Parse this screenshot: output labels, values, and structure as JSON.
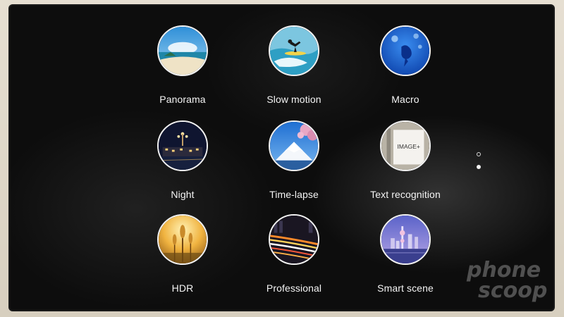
{
  "modes": [
    {
      "label": "Panorama",
      "icon": "panorama-beach-icon"
    },
    {
      "label": "Slow motion",
      "icon": "surfer-icon"
    },
    {
      "label": "Macro",
      "icon": "water-drop-icon"
    },
    {
      "label": "Night",
      "icon": "night-city-icon"
    },
    {
      "label": "Time-lapse",
      "icon": "mountain-blossom-icon"
    },
    {
      "label": "Text recognition",
      "icon": "document-text-icon",
      "thumb_text": "IMAGE+"
    },
    {
      "label": "HDR",
      "icon": "wheat-sunset-icon"
    },
    {
      "label": "Professional",
      "icon": "light-trails-icon"
    },
    {
      "label": "Smart scene",
      "icon": "skyline-icon"
    }
  ],
  "pager": {
    "pages": 2,
    "current": 2
  },
  "watermark": {
    "line1": "phone",
    "line2": "scoop"
  },
  "colors": {
    "screen": "#0d0d0d",
    "label": "#f4f4f4",
    "ring": "#f2f2f2"
  }
}
